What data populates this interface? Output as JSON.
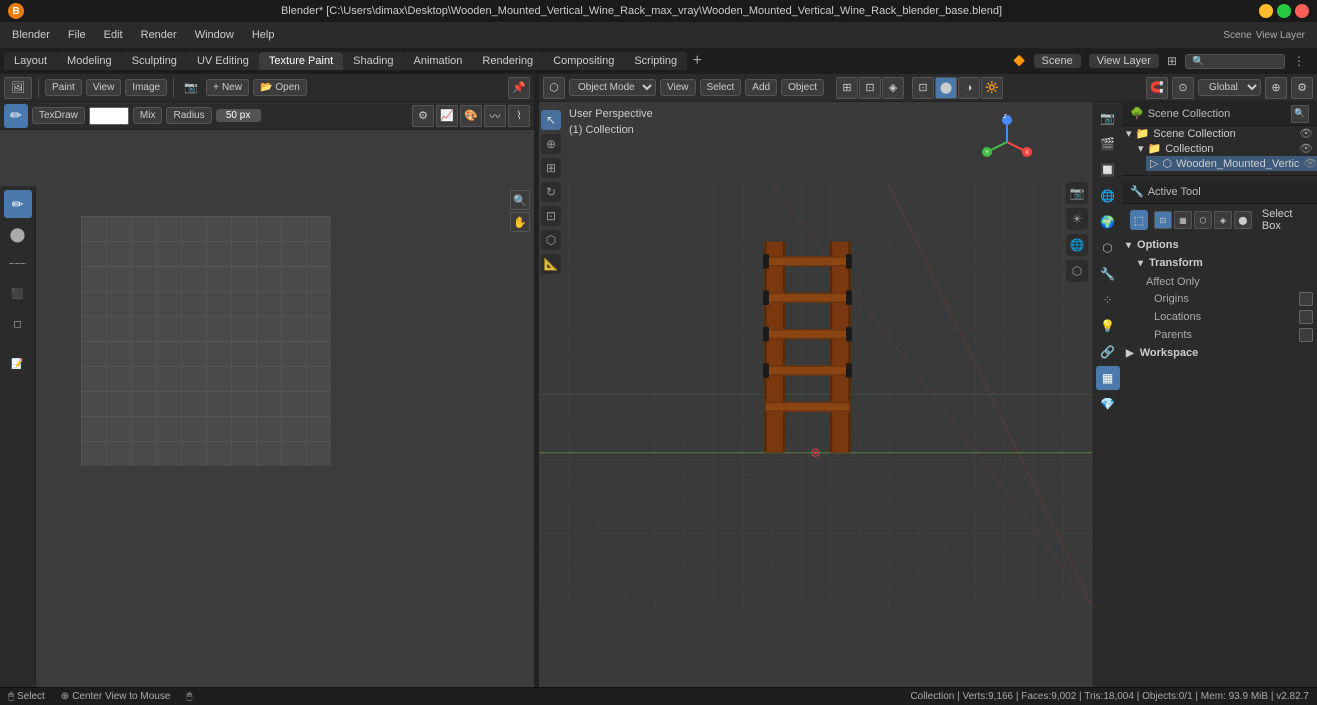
{
  "titlebar": {
    "title": "Blender* [C:\\Users\\dimax\\Desktop\\Wooden_Mounted_Vertical_Wine_Rack_max_vray\\Wooden_Mounted_Vertical_Wine_Rack_blender_base.blend]",
    "icon": "B"
  },
  "menubar": {
    "items": [
      "Blender",
      "File",
      "Edit",
      "Render",
      "Window",
      "Help"
    ]
  },
  "workspacetabs": {
    "tabs": [
      "Layout",
      "Modeling",
      "Sculpting",
      "UV Editing",
      "Texture Paint",
      "Shading",
      "Animation",
      "Rendering",
      "Compositing",
      "Scripting"
    ],
    "active": "Texture Paint",
    "active_index": 4,
    "scene_label": "Scene",
    "viewlayer_label": "View Layer"
  },
  "left_editor": {
    "toolbar_top": {
      "paint_label": "Paint",
      "view_label": "View",
      "image_label": "Image",
      "new_label": "New",
      "open_label": "Open"
    },
    "toolbar_bottom": {
      "brush_label": "TexDraw",
      "color_box": "#ffffff",
      "blend_label": "Mix",
      "radius_label": "Radius",
      "radius_value": "50 px"
    },
    "tools": [
      {
        "name": "draw",
        "icon": "✏",
        "active": true
      },
      {
        "name": "fill",
        "icon": "⬤",
        "active": false
      },
      {
        "name": "smear",
        "icon": "~",
        "active": false
      },
      {
        "name": "clone",
        "icon": "⧉",
        "active": false
      },
      {
        "name": "erase",
        "icon": "◻",
        "active": false
      }
    ]
  },
  "viewport": {
    "perspective": "User Perspective",
    "collection": "(1) Collection",
    "mode": "Object Mode",
    "view_label": "View",
    "select_label": "Select",
    "add_label": "Add",
    "object_label": "Object",
    "transform": "Global",
    "shading_modes": [
      "wireframe",
      "solid",
      "material",
      "rendered"
    ]
  },
  "outliner": {
    "header": "Scene Collection",
    "items": [
      {
        "label": "Scene Collection",
        "level": 0,
        "icon": "📁"
      },
      {
        "label": "Collection",
        "level": 1,
        "icon": "📁",
        "visible": true
      },
      {
        "label": "Wooden_Mounted_Vertic",
        "level": 2,
        "icon": "⬡",
        "visible": true
      }
    ]
  },
  "properties": {
    "active_tab": "tool",
    "select_box_label": "Select Box",
    "options_header": "Options",
    "transform_header": "Transform",
    "affect_only_label": "Affect Only",
    "origins_label": "Origins",
    "locations_label": "Locations",
    "parents_label": "Parents",
    "workspace_header": "Workspace",
    "prop_icons": [
      "🖥",
      "🎬",
      "🌐",
      "🎥",
      "💡",
      "🔧",
      "⬡",
      "🖼",
      "💎",
      "🔲"
    ]
  },
  "statusbar": {
    "select_label": "Select",
    "center_view_label": "Center View to Mouse",
    "stats": "Collection | Verts:9,166 | Faces:9,002 | Tris:18,004 | Objects:0/1 | Mem: 93.9 MiB | v2.82.7",
    "version": "v2.82.7"
  },
  "colors": {
    "accent": "#4a7aad",
    "background_dark": "#1e1e1e",
    "background_mid": "#2b2b2b",
    "background_light": "#3c3c3c",
    "panel_border": "#222222",
    "text_primary": "#dddddd",
    "text_secondary": "#aaaaaa",
    "active_tab": "#3c3c3c",
    "object_brown": "#8B4513"
  }
}
